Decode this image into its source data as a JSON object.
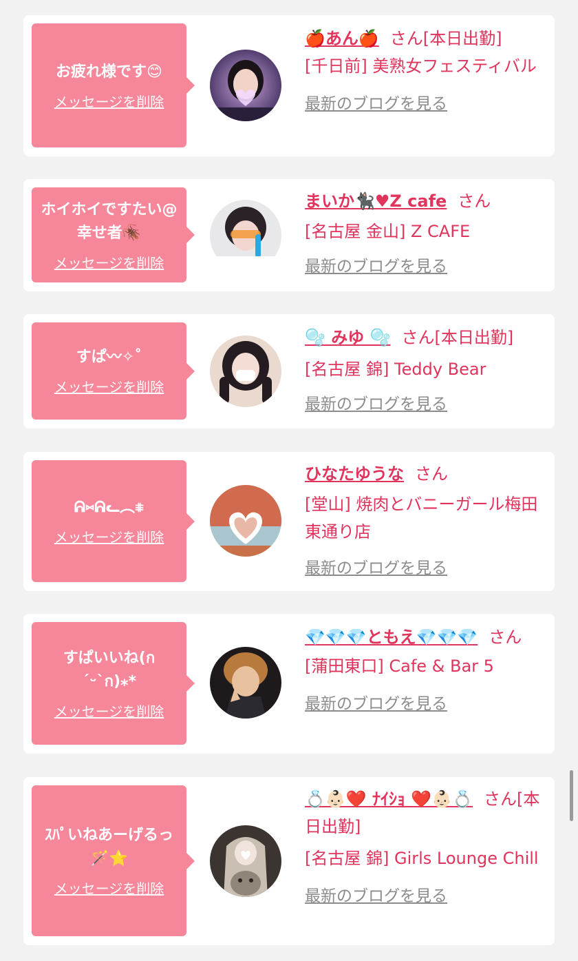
{
  "cards": [
    {
      "message": "お疲れ様です😊",
      "delete_label": "メッセージを削除",
      "name": "🍎あん🍎",
      "suffix": "さん[本日出勤]",
      "shop": "[千日前] 美熟女フェスティバル",
      "blog_label": "最新のブログを見る"
    },
    {
      "message": "ホイホイですたい@幸せ者🪳",
      "delete_label": "メッセージを削除",
      "name": "まいか🐈‍⬛♥Z cafe",
      "suffix": "さん",
      "shop": "[名古屋 金山] Z CAFE",
      "blog_label": "最新のブログを見る"
    },
    {
      "message": "すぱ〰✧˚",
      "delete_label": "メッセージを削除",
      "name": "🫧 みゆ 🫧",
      "suffix": "さん[本日出勤]",
      "shop": "[名古屋 錦] Teddy Bear",
      "blog_label": "最新のブログを見る"
    },
    {
      "message": "ᕱ⑅ᕱ︎ᓚ︎︎︵⩨",
      "delete_label": "メッセージを削除",
      "name": "ひなたゆうな",
      "suffix": "さん",
      "shop": "[堂山] 焼肉とバニーガール梅田東通り店",
      "blog_label": "最新のブログを見る"
    },
    {
      "message": "すぱいいね(ก´ᵕ`ก)⁎*",
      "delete_label": "メッセージを削除",
      "name": "💎💎💎ともえ💎💎💎",
      "suffix": "さん",
      "shop": "[蒲田東口] Cafe & Bar 5",
      "blog_label": "最新のブログを見る"
    },
    {
      "message": "ｽﾊﾟいねあーげるっ🪄⭐",
      "delete_label": "メッセージを削除",
      "name": "💍👶🏻❤️ ﾅｲｼｮ ❤️👶🏻💍",
      "suffix": "さん[本日出勤]",
      "shop": "[名古屋 錦] Girls Lounge Chill",
      "blog_label": "最新のブログを見る"
    }
  ],
  "colors": {
    "accent": "#e0345c",
    "bubble": "#f6879a",
    "muted_link": "#8c8c8c",
    "background": "#f2f2f2"
  }
}
